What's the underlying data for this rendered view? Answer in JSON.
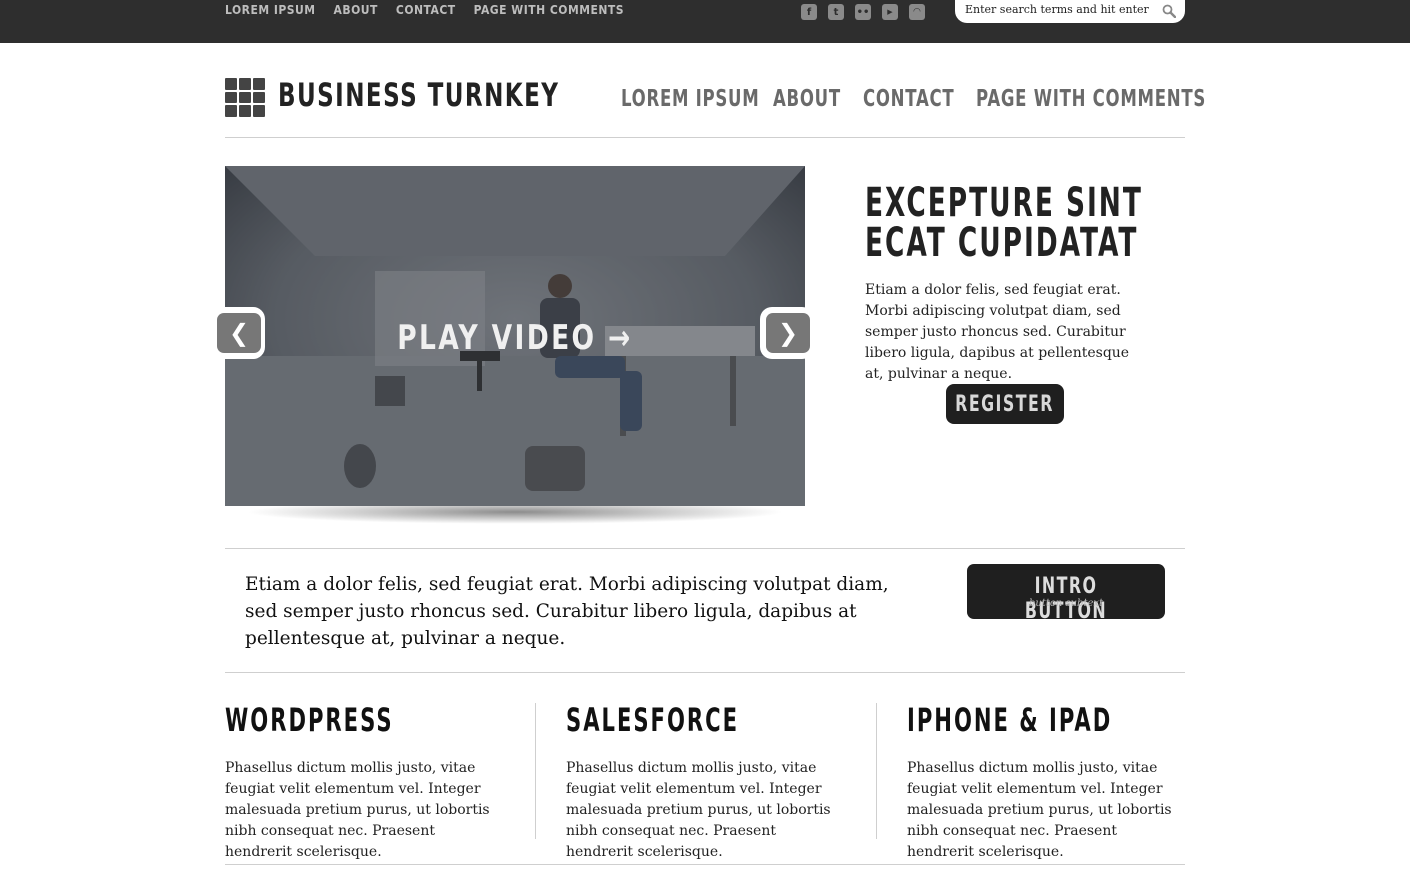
{
  "topbar": {
    "nav": [
      "LOREM IPSUM",
      "ABOUT",
      "CONTACT",
      "PAGE WITH COMMENTS"
    ],
    "social_icons": [
      "facebook-icon",
      "twitter-icon",
      "flickr-icon",
      "youtube-icon",
      "rss-icon"
    ],
    "search_placeholder": "Enter search terms and hit enter"
  },
  "header": {
    "logo_text": "BUSINESS TURNKEY",
    "nav": [
      "LOREM IPSUM",
      "ABOUT",
      "CONTACT",
      "PAGE WITH COMMENTS"
    ]
  },
  "slider": {
    "play_label": "PLAY VIDEO →",
    "prev": "❮",
    "next": "❯"
  },
  "hero": {
    "title_line1": "EXCEPTURE SINT",
    "title_line2": "ECAT CUPIDATAT",
    "text": "Etiam a dolor felis, sed feugiat erat. Morbi adipiscing volutpat diam, sed semper justo rhoncus sed. Curabitur libero ligula, dapibus at pellentesque at, pulvinar a neque.",
    "register_label": "REGISTER"
  },
  "intro": {
    "text": "Etiam a dolor felis, sed feugiat erat. Morbi adipiscing volutpat diam, sed semper justo rhoncus sed. Curabitur libero ligula, dapibus at pellentesque at, pulvinar a neque.",
    "button_label": "INTRO BUTTON",
    "button_subtext": "button subtext"
  },
  "columns": [
    {
      "title": "WORDPRESS",
      "text": "Phasellus dictum mollis justo, vitae feugiat velit elementum vel. Integer malesuada pretium purus, ut lobortis nibh consequat nec. Praesent hendrerit scelerisque."
    },
    {
      "title": "SALESFORCE",
      "text": "Phasellus dictum mollis justo, vitae feugiat velit elementum vel. Integer malesuada pretium purus, ut lobortis nibh consequat nec. Praesent hendrerit scelerisque."
    },
    {
      "title": "IPHONE & IPAD",
      "text": "Phasellus dictum mollis justo, vitae feugiat velit elementum vel. Integer malesuada pretium purus, ut lobortis nibh consequat nec. Praesent hendrerit scelerisque."
    }
  ],
  "colors": {
    "topbar_bg": "#2e2e2e",
    "button_bg": "#1f1f1f",
    "nav_text": "#6a6a6a"
  }
}
